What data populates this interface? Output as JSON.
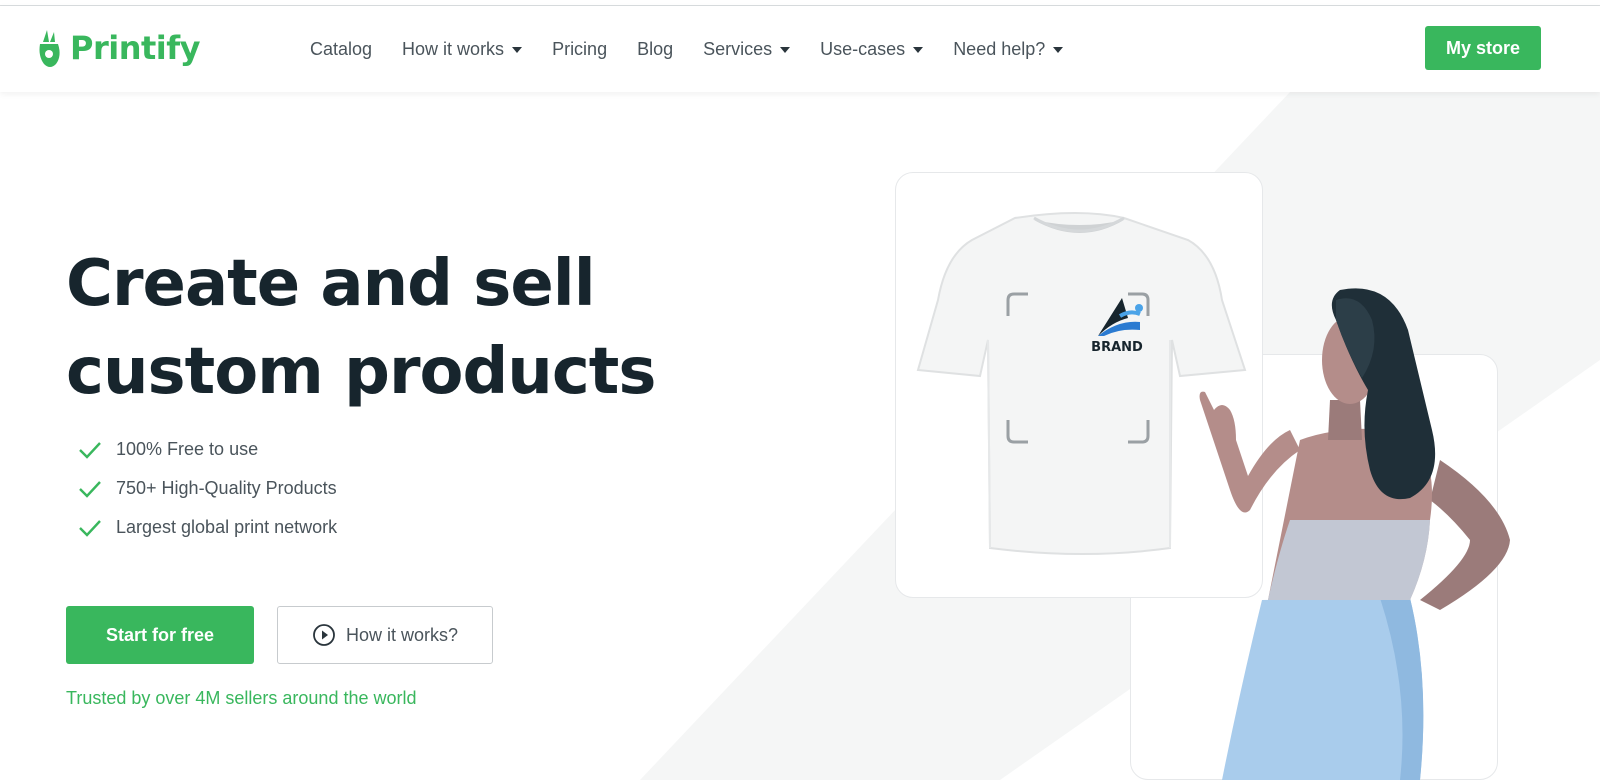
{
  "brand": {
    "name": "Printify",
    "color": "#39b75d",
    "icon": "printify-logo-icon"
  },
  "nav": {
    "items": [
      {
        "label": "Catalog",
        "dropdown": false
      },
      {
        "label": "How it works",
        "dropdown": true
      },
      {
        "label": "Pricing",
        "dropdown": false
      },
      {
        "label": "Blog",
        "dropdown": false
      },
      {
        "label": "Services",
        "dropdown": true
      },
      {
        "label": "Use-cases",
        "dropdown": true
      },
      {
        "label": "Need help?",
        "dropdown": true
      }
    ],
    "my_store": "My store"
  },
  "hero": {
    "title_line1": "Create and sell",
    "title_line2": "custom products",
    "features": [
      "100% Free to use",
      "750+ High-Quality Products",
      "Largest global print network"
    ],
    "primary_cta": "Start for free",
    "secondary_cta": "How it works?",
    "trusted": "Trusted by over 4M sellers around the world"
  },
  "illustration": {
    "tshirt_logo_text": "BRAND",
    "icons": [
      "tshirt-icon",
      "brand-logo-icon",
      "woman-pointing-illustration"
    ]
  },
  "colors": {
    "accent": "#39b75d",
    "heading": "#17252d",
    "text": "#4a545b",
    "skirt": "#a9ccec"
  }
}
